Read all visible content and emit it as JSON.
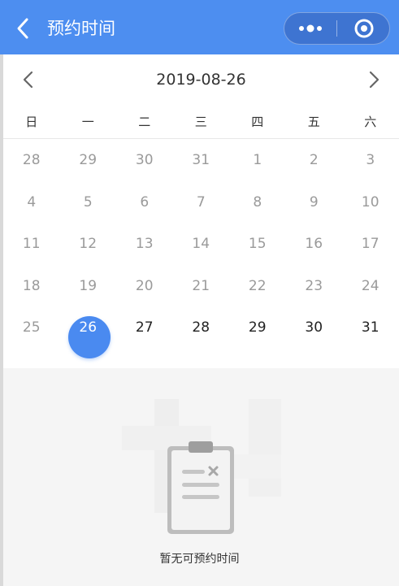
{
  "navbar": {
    "title": "预约时间",
    "back_icon": "chevron-left-icon",
    "more_icon": "more-dots-icon",
    "close_icon": "target-circle-icon",
    "bg_color": "#4d8ef0"
  },
  "calendar": {
    "current_date": "2019-08-26",
    "prev_icon": "chevron-left-icon",
    "next_icon": "chevron-right-icon",
    "weekdays": [
      "日",
      "一",
      "二",
      "三",
      "四",
      "五",
      "六"
    ],
    "days": [
      {
        "label": "28",
        "state": "inactive"
      },
      {
        "label": "29",
        "state": "inactive"
      },
      {
        "label": "30",
        "state": "inactive"
      },
      {
        "label": "31",
        "state": "inactive"
      },
      {
        "label": "1",
        "state": "inactive"
      },
      {
        "label": "2",
        "state": "inactive"
      },
      {
        "label": "3",
        "state": "inactive"
      },
      {
        "label": "4",
        "state": "inactive"
      },
      {
        "label": "5",
        "state": "inactive"
      },
      {
        "label": "6",
        "state": "inactive"
      },
      {
        "label": "7",
        "state": "inactive"
      },
      {
        "label": "8",
        "state": "inactive"
      },
      {
        "label": "9",
        "state": "inactive"
      },
      {
        "label": "10",
        "state": "inactive"
      },
      {
        "label": "11",
        "state": "inactive"
      },
      {
        "label": "12",
        "state": "inactive"
      },
      {
        "label": "13",
        "state": "inactive"
      },
      {
        "label": "14",
        "state": "inactive"
      },
      {
        "label": "15",
        "state": "inactive"
      },
      {
        "label": "16",
        "state": "inactive"
      },
      {
        "label": "17",
        "state": "inactive"
      },
      {
        "label": "18",
        "state": "inactive"
      },
      {
        "label": "19",
        "state": "inactive"
      },
      {
        "label": "20",
        "state": "inactive"
      },
      {
        "label": "21",
        "state": "inactive"
      },
      {
        "label": "22",
        "state": "inactive"
      },
      {
        "label": "23",
        "state": "inactive"
      },
      {
        "label": "24",
        "state": "inactive"
      },
      {
        "label": "25",
        "state": "inactive"
      },
      {
        "label": "26",
        "state": "selected"
      },
      {
        "label": "27",
        "state": "active"
      },
      {
        "label": "28",
        "state": "active"
      },
      {
        "label": "29",
        "state": "active"
      },
      {
        "label": "30",
        "state": "active"
      },
      {
        "label": "31",
        "state": "active"
      }
    ],
    "selected_color": "#4a8af0"
  },
  "empty_state": {
    "icon": "empty-clipboard-icon",
    "message": "暂无可预约时间"
  }
}
